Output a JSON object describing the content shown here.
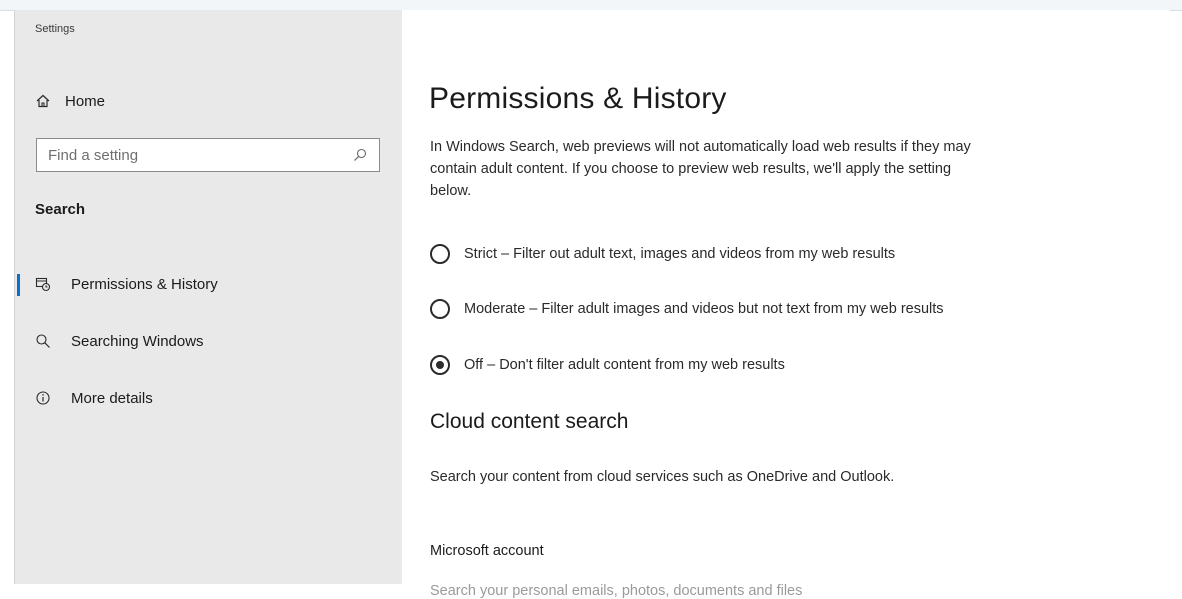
{
  "window": {
    "title": "Settings"
  },
  "sidebar": {
    "home_label": "Home",
    "search": {
      "placeholder": "Find a setting",
      "value": ""
    },
    "section_label": "Search",
    "items": [
      {
        "label": "Permissions & History",
        "icon": "permissions-history-icon",
        "selected": true
      },
      {
        "label": "Searching Windows",
        "icon": "search-icon",
        "selected": false
      },
      {
        "label": "More details",
        "icon": "info-icon",
        "selected": false
      }
    ]
  },
  "main": {
    "title": "Permissions & History",
    "intro": "In Windows Search, web previews will not automatically load web results if they may contain adult content. If you choose to preview web results, we'll apply the setting below.",
    "safesearch_options": [
      {
        "label": "Strict – Filter out adult text, images and videos from my web results",
        "selected": false
      },
      {
        "label": "Moderate – Filter adult images and videos but not text from my web results",
        "selected": false
      },
      {
        "label": "Off – Don't filter adult content from my web results",
        "selected": true
      }
    ],
    "cloud_section_title": "Cloud content search",
    "cloud_description": "Search your content from cloud services such as OneDrive and Outlook.",
    "microsoft_account_label": "Microsoft account",
    "microsoft_account_desc": "Search your personal emails, photos, documents and files"
  },
  "colors": {
    "accent": "#0b6fd0",
    "sidebar_bg": "#e9e9e9",
    "main_bg": "#ffffff"
  }
}
